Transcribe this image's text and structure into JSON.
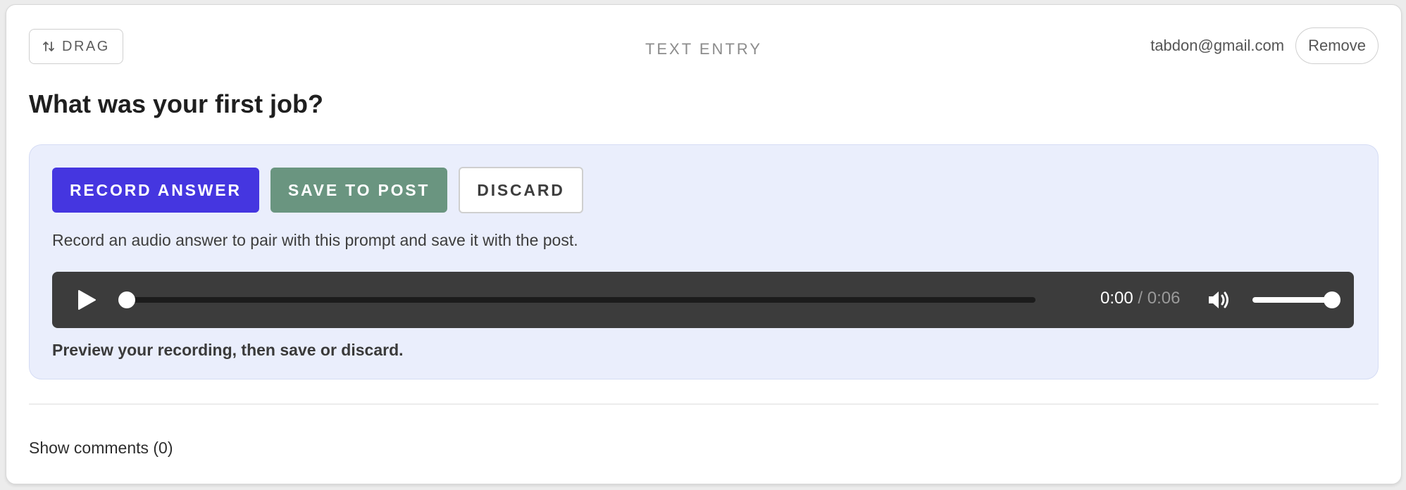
{
  "header": {
    "drag_label": "DRAG",
    "drag_icon": "swap-vertical-icon",
    "entry_type": "TEXT ENTRY",
    "user_email": "tabdon@gmail.com",
    "remove_label": "Remove"
  },
  "question": {
    "title": "What was your first job?"
  },
  "record_panel": {
    "record_label": "RECORD ANSWER",
    "save_label": "SAVE TO POST",
    "discard_label": "DISCARD",
    "hint": "Record an audio answer to pair with this prompt and save it with the post.",
    "preview_note": "Preview your recording, then save or discard.",
    "colors": {
      "record_button": "#4536e0",
      "save_button": "#6a9580",
      "panel_background": "#eaeefc"
    }
  },
  "audio_player": {
    "play_icon": "play-icon",
    "volume_icon": "volume-icon",
    "current_time": "0:00",
    "separator": "/",
    "total_time": "0:06",
    "progress_fraction": 0.0,
    "volume_fraction": 1.0
  },
  "comments": {
    "toggle_label": "Show comments (0)"
  }
}
